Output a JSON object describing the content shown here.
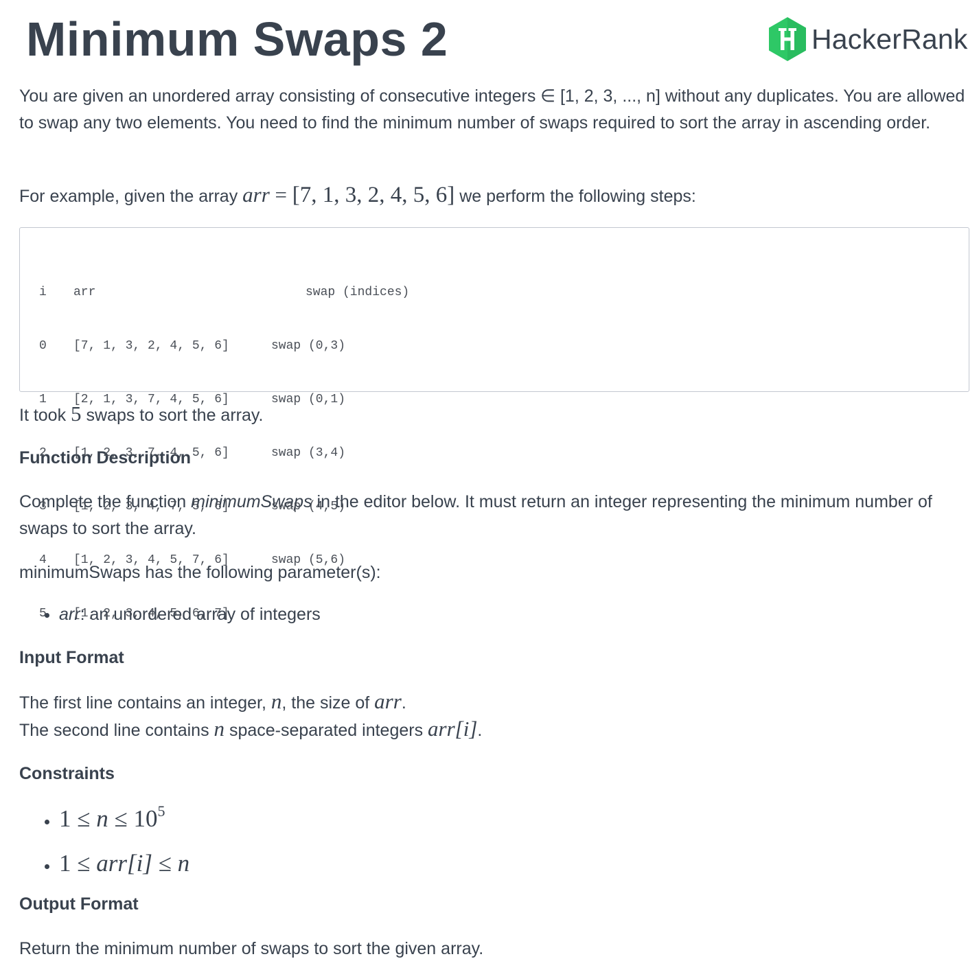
{
  "header": {
    "title": "Minimum Swaps 2",
    "brand_name": "HackerRank",
    "brand_color": "#2ec866",
    "logo_icon": "hackerrank-hex-icon"
  },
  "intro": {
    "text": "You are given an unordered array consisting of consecutive integers ∈ [1, 2, 3, ..., n] without any duplicates. You are allowed to swap any two elements. You need to find the minimum number of swaps required to sort the array in ascending order."
  },
  "example": {
    "prefix": "For example, given the array ",
    "arr_var": "arr",
    "equals": " = ",
    "arr_value": "[7, 1, 3, 2, 4, 5, 6]",
    "suffix": " we perform the following steps:"
  },
  "steps_table": {
    "header": {
      "i": "i",
      "arr": "arr",
      "swap": "swap (indices)"
    },
    "rows": [
      {
        "i": "0",
        "arr": "[7, 1, 3, 2, 4, 5, 6]",
        "swap": "swap (0,3)"
      },
      {
        "i": "1",
        "arr": "[2, 1, 3, 7, 4, 5, 6]",
        "swap": "swap (0,1)"
      },
      {
        "i": "2",
        "arr": "[1, 2, 3, 7, 4, 5, 6]",
        "swap": "swap (3,4)"
      },
      {
        "i": "3",
        "arr": "[1, 2, 3, 4, 7, 5, 6]",
        "swap": "swap (4,5)"
      },
      {
        "i": "4",
        "arr": "[1, 2, 3, 4, 5, 7, 6]",
        "swap": "swap (5,6)"
      },
      {
        "i": "5",
        "arr": "[1, 2, 3, 4, 5, 6, 7]",
        "swap": ""
      }
    ]
  },
  "result": {
    "prefix": "It took ",
    "count": "5",
    "suffix": " swaps to sort the array."
  },
  "function_description": {
    "heading": "Function Description",
    "text_prefix": "Complete the function ",
    "function_name": "minimumSwaps",
    "text_suffix": " in the editor below. It must return an integer representing the minimum number of swaps to sort the array.",
    "params_intro": "minimumSwaps has the following parameter(s):",
    "params": [
      {
        "name": "arr",
        "desc": ": an unordered array of integers"
      }
    ]
  },
  "input_format": {
    "heading": "Input Format",
    "line1_prefix": "The first line contains an integer, ",
    "line1_var": "n",
    "line1_mid": ", the size of ",
    "line1_var2": "arr",
    "line1_end": ".",
    "line2_prefix": "The second line contains ",
    "line2_var": "n",
    "line2_mid": " space-separated integers ",
    "line2_var2": "arr",
    "line2_index": "[i]",
    "line2_end": "."
  },
  "constraints": {
    "heading": "Constraints",
    "c1": {
      "lhs": "1",
      "op1": " ≤ ",
      "var": "n",
      "op2": " ≤ ",
      "base": "10",
      "exp": "5"
    },
    "c2": {
      "lhs": "1",
      "op1": " ≤ ",
      "var": "arr",
      "idx": "[i]",
      "op2": " ≤ ",
      "rhs": "n"
    }
  },
  "output_format": {
    "heading": "Output Format",
    "text": "Return the minimum number of swaps to sort the given array."
  }
}
